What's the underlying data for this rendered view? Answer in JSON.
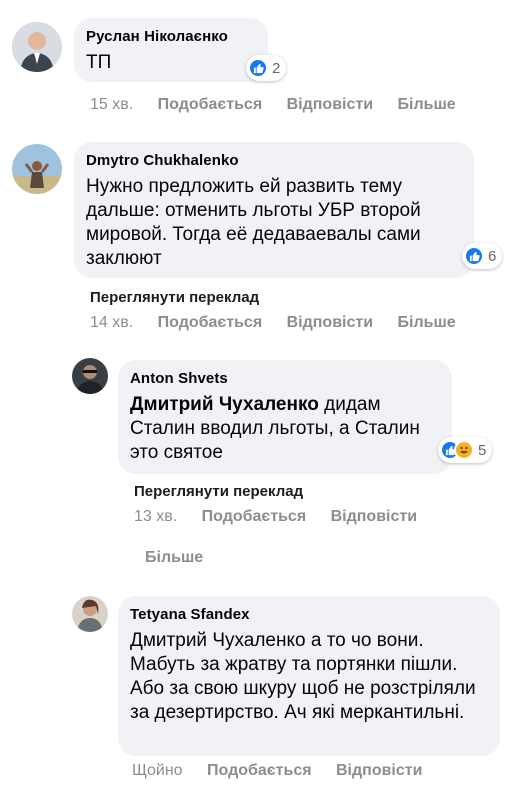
{
  "comments": [
    {
      "author": "Руслан Ніколаєнко",
      "text": "ТП",
      "reactions": {
        "icons": [
          "like"
        ],
        "count": "2"
      },
      "time": "15 хв.",
      "actions": [
        "Подобається",
        "Відповісти",
        "Більше"
      ]
    },
    {
      "author": "Dmytro Chukhalenko",
      "text": "Нужно предложить ей развить тему дальше: отменить льготы УБР второй мировой. Тогда её дедаваевалы сами заклюют",
      "reactions": {
        "icons": [
          "like"
        ],
        "count": "6"
      },
      "translate": "Переглянути переклад",
      "time": "14 хв.",
      "actions": [
        "Подобається",
        "Відповісти",
        "Більше"
      ]
    },
    {
      "author": "Anton Shvets",
      "mention": "Дмитрий Чухаленко",
      "text": " дидам Сталин вводил льготы, а Сталин это святое",
      "reactions": {
        "icons": [
          "like",
          "haha"
        ],
        "count": "5"
      },
      "translate": "Переглянути переклад",
      "time": "13 хв.",
      "actions": [
        "Подобається",
        "Відповісти",
        "Більше"
      ]
    },
    {
      "author": "Tetyana Sfandex",
      "text": "Дмитрий Чухаленко а то чо вони. Мабуть за жратву та портянки пішли. Або за свою шкуру щоб не розстріляли за дезертирство. Ач які меркантильні.",
      "time": "Щойно",
      "actions": [
        "Подобається",
        "Відповісти"
      ]
    }
  ],
  "colors": {
    "bubble": "#f0f2f5",
    "meta": "#8a8d91",
    "like": "#1877f2",
    "haha": "#f7b125"
  }
}
